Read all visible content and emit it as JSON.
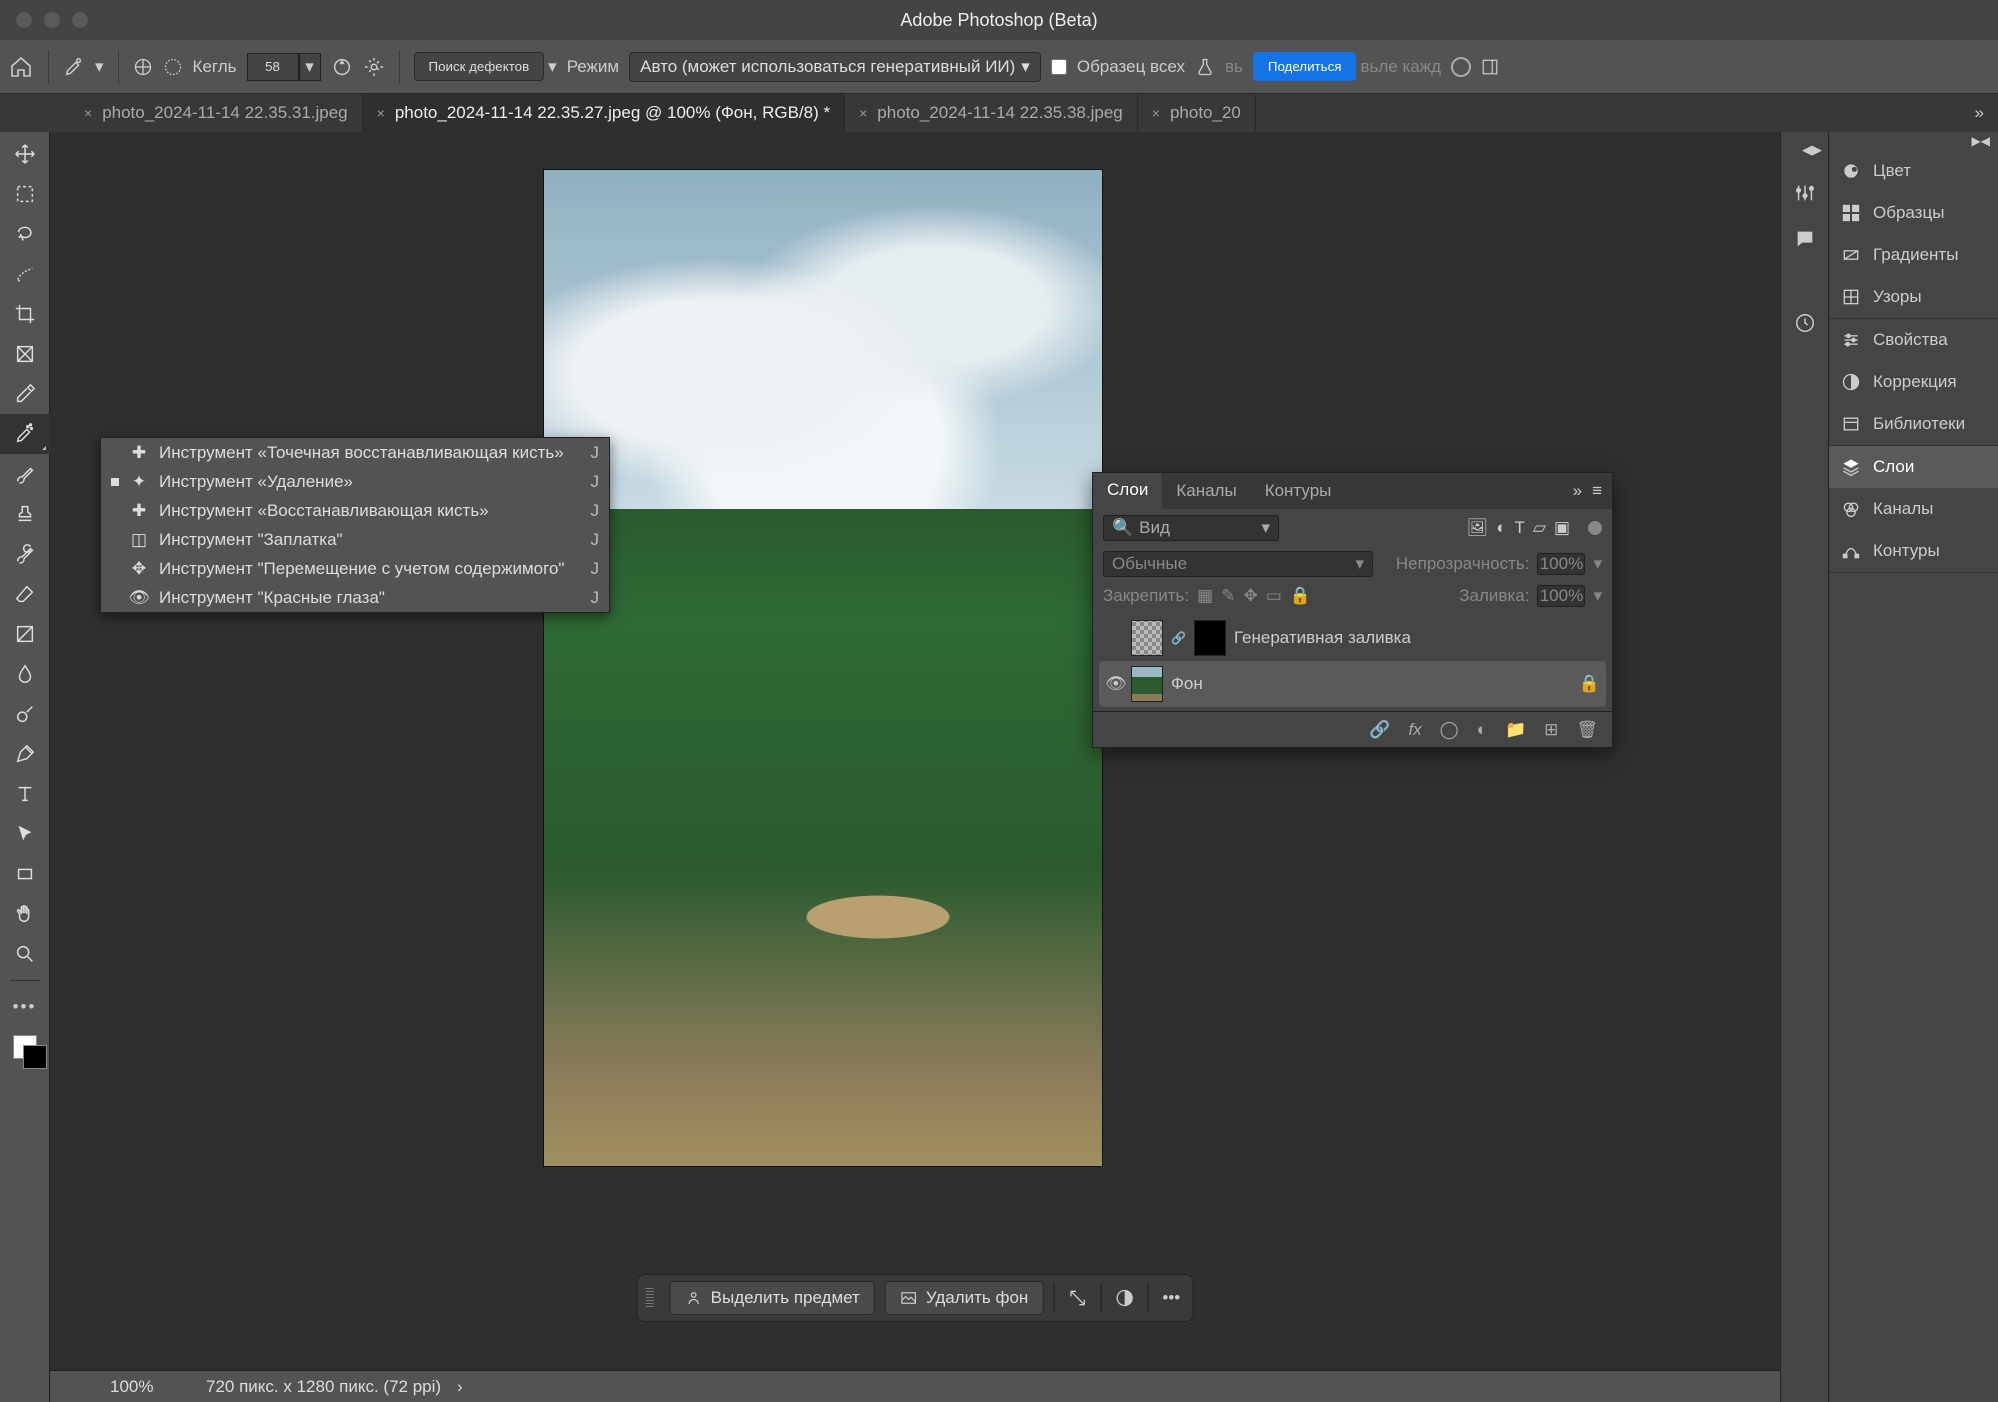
{
  "titlebar": {
    "title": "Adobe Photoshop (Beta)"
  },
  "optionbar": {
    "kegl_label": "Кегль",
    "kegl_value": "58",
    "defects_btn": "Поиск дефектов",
    "mode_label": "Режим",
    "mode_value": "Авто (может использоваться генеративный ИИ)",
    "sample_all": "Образец всех",
    "share_btn": "Поделиться",
    "trailing_text": "вьле кажд"
  },
  "tabs": [
    {
      "label": "photo_2024-11-14 22.35.31.jpeg"
    },
    {
      "label": "photo_2024-11-14 22.35.27.jpeg @ 100% (Фон, RGB/8) *"
    },
    {
      "label": "photo_2024-11-14 22.35.38.jpeg"
    },
    {
      "label": "photo_20"
    }
  ],
  "flyout": [
    {
      "label": "Инструмент «Точечная восстанавливающая кисть»",
      "key": "J"
    },
    {
      "label": "Инструмент «Удаление»",
      "key": "J"
    },
    {
      "label": "Инструмент «Восстанавливающая кисть»",
      "key": "J"
    },
    {
      "label": "Инструмент \"Заплатка\"",
      "key": "J"
    },
    {
      "label": "Инструмент \"Перемещение с учетом содержимого\"",
      "key": "J"
    },
    {
      "label": "Инструмент \"Красные глаза\"",
      "key": "J"
    }
  ],
  "ctxbar": {
    "select_subject": "Выделить предмет",
    "remove_bg": "Удалить фон"
  },
  "status": {
    "zoom": "100%",
    "dims": "720 пикс. x 1280 пикс. (72 ppi)"
  },
  "layers_panel": {
    "tabs": [
      "Слои",
      "Каналы",
      "Контуры"
    ],
    "search_label": "Вид",
    "blend_mode": "Обычные",
    "opacity_label": "Непрозрачность:",
    "opacity_value": "100%",
    "lock_label": "Закрепить:",
    "fill_label": "Заливка:",
    "fill_value": "100%",
    "layers": [
      {
        "name": "Генеративная заливка"
      },
      {
        "name": "Фон"
      }
    ]
  },
  "right_panels": {
    "group1": [
      "Цвет",
      "Образцы",
      "Градиенты",
      "Узоры"
    ],
    "group2": [
      "Свойства",
      "Коррекция",
      "Библиотеки"
    ],
    "group3": [
      "Слои",
      "Каналы",
      "Контуры"
    ]
  }
}
